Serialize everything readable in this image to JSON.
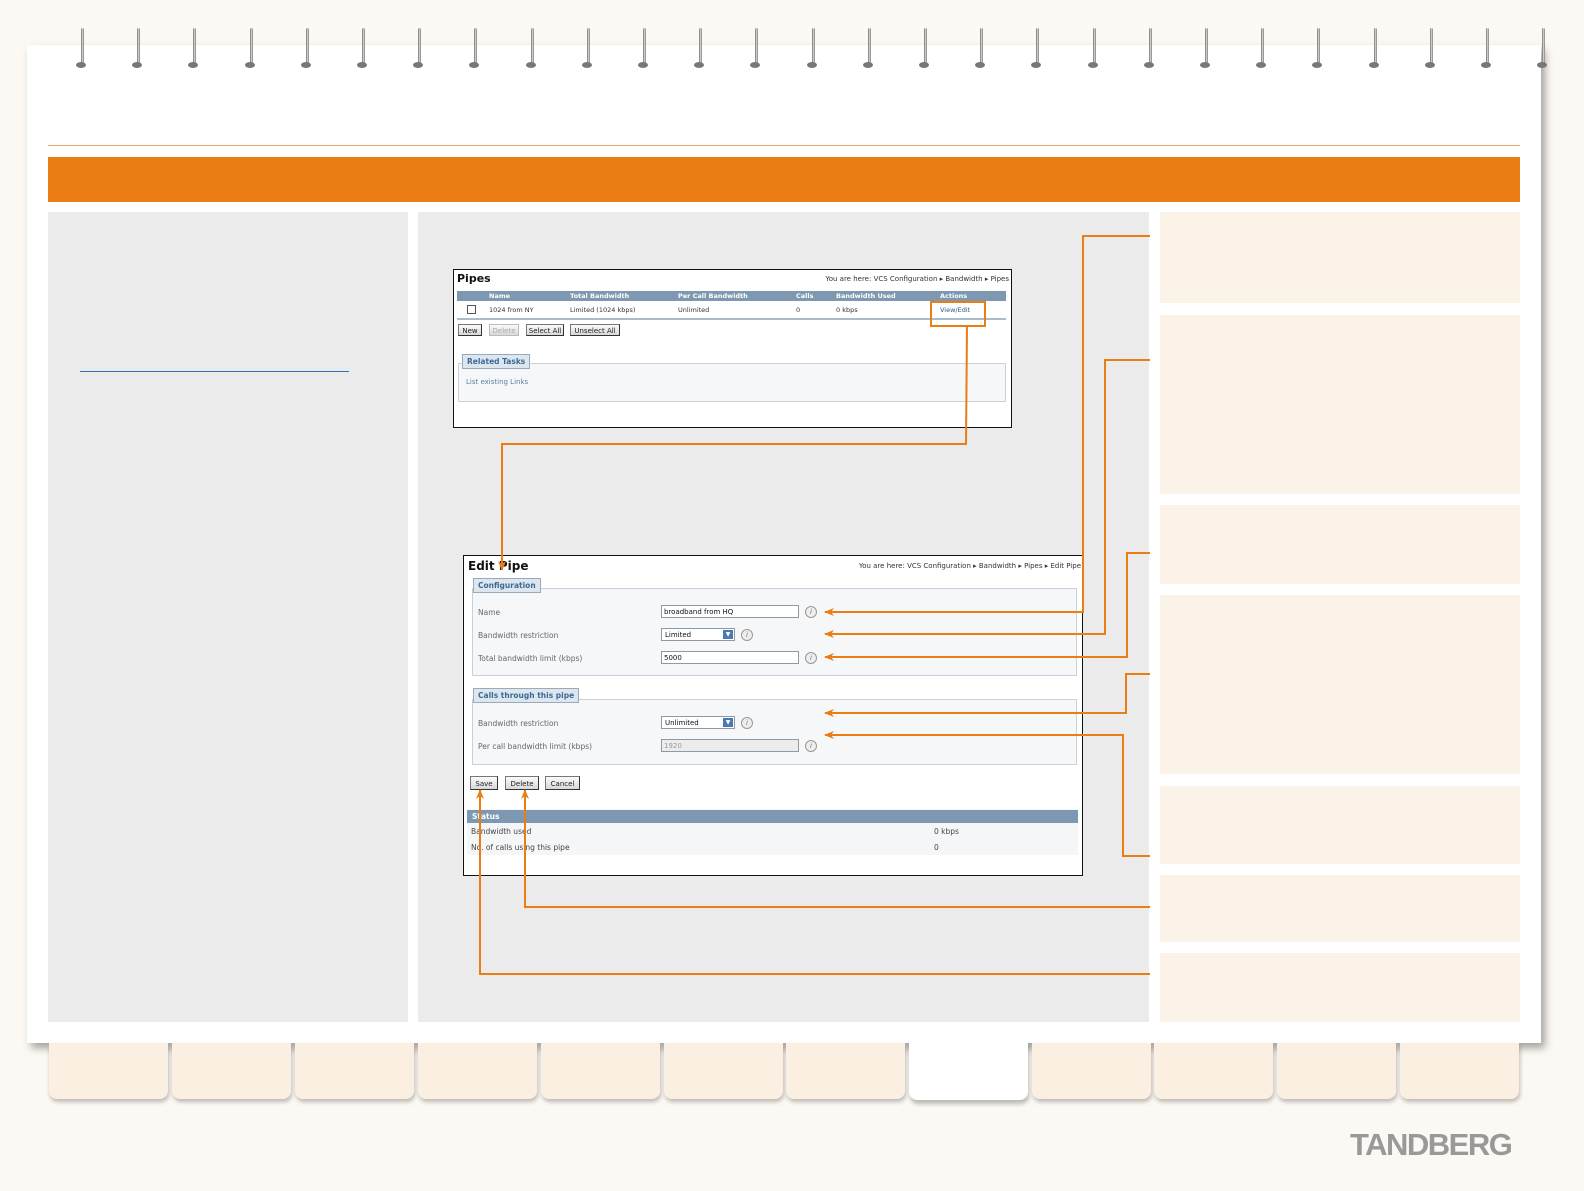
{
  "pipes_window": {
    "title": "Pipes",
    "breadcrumb": "You are here: VCS Configuration ▸ Bandwidth ▸ Pipes",
    "columns": [
      "Name",
      "Total Bandwidth",
      "Per Call Bandwidth",
      "Calls",
      "Bandwidth Used",
      "Actions"
    ],
    "row": {
      "name": "1024 from NY",
      "total_bandwidth": "Limited (1024 kbps)",
      "per_call_bandwidth": "Unlimited",
      "calls": "0",
      "bandwidth_used": "0 kbps",
      "action": "View/Edit"
    },
    "buttons": {
      "new": "New",
      "delete": "Delete",
      "select_all": "Select All",
      "unselect_all": "Unselect All"
    },
    "related_tasks": {
      "legend": "Related Tasks",
      "link": "List existing Links"
    }
  },
  "edit_window": {
    "title": "Edit Pipe",
    "breadcrumb": "You are here: VCS Configuration ▸ Bandwidth ▸ Pipes ▸ Edit Pipe",
    "configuration": {
      "legend": "Configuration",
      "name_label": "Name",
      "name_value": "broadband from HQ",
      "restriction_label": "Bandwidth restriction",
      "restriction_value": "Limited",
      "total_limit_label": "Total bandwidth limit (kbps)",
      "total_limit_value": "5000"
    },
    "calls": {
      "legend": "Calls through this pipe",
      "restriction_label": "Bandwidth restriction",
      "restriction_value": "Unlimited",
      "per_call_label": "Per call bandwidth limit (kbps)",
      "per_call_value": "1920"
    },
    "buttons": {
      "save": "Save",
      "delete": "Delete",
      "cancel": "Cancel"
    },
    "status": {
      "header": "Status",
      "bw_used_label": "Bandwidth used",
      "bw_used_value": "0 kbps",
      "calls_label": "No. of calls using this pipe",
      "calls_value": "0"
    }
  },
  "logo": "TANDBERG",
  "colors": {
    "accent_orange": "#ea7d14",
    "panel_grey": "#ebebeb",
    "note_bg": "#fcf3e8",
    "table_header": "#7d98b0"
  }
}
